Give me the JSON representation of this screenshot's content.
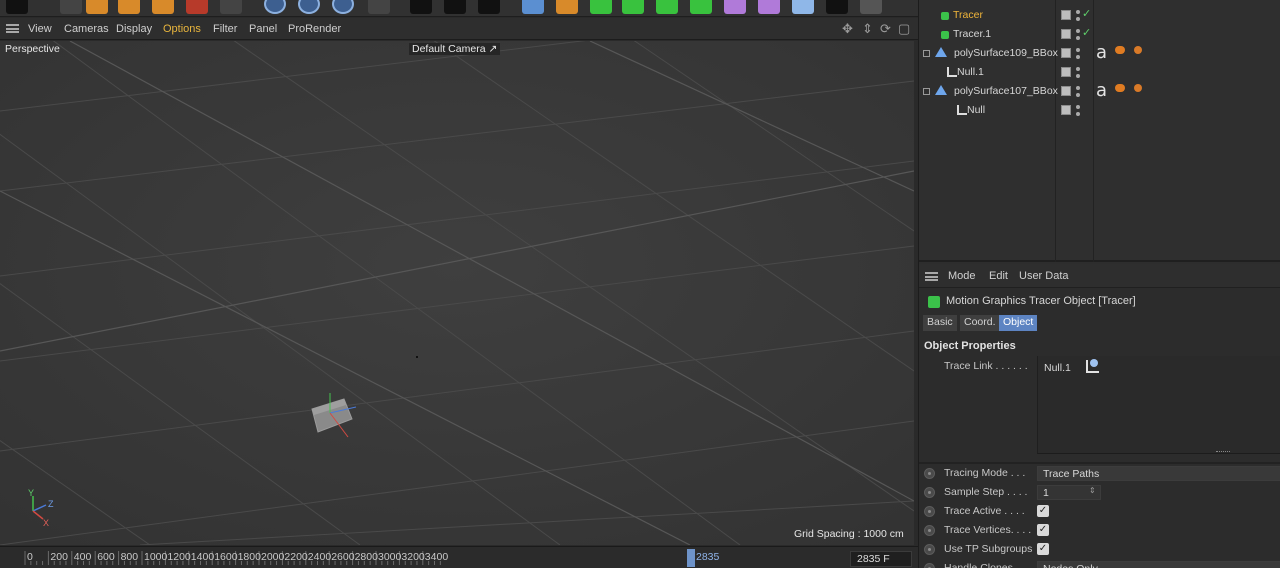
{
  "viewport": {
    "menu": [
      "View",
      "Cameras",
      "Display",
      "Options",
      "Filter",
      "Panel",
      "ProRender"
    ],
    "active_menu": "Options",
    "view_name": "Perspective",
    "camera_name": "Default Camera",
    "camera_suffix": "↗",
    "grid_spacing": "Grid Spacing : 1000 cm",
    "axis_labels": {
      "y": "Y",
      "z": "Z",
      "x": "X"
    }
  },
  "timeline": {
    "ticks": [
      "0",
      "200",
      "400",
      "600",
      "800",
      "1000",
      "1200",
      "1400",
      "1600",
      "1800",
      "2000",
      "2200",
      "2400",
      "2600",
      "2800",
      "3000",
      "3200",
      "3400"
    ],
    "current_frame": "2835",
    "frame_field": "2835 F"
  },
  "object_manager": {
    "rows": [
      {
        "name": "Tracer",
        "selected": true,
        "icon": "tracer-icon",
        "check": true
      },
      {
        "name": "Tracer.1",
        "selected": false,
        "icon": "tracer-icon",
        "check": true
      },
      {
        "name": "polySurface109_BBox",
        "selected": false,
        "icon": "polygon-object-icon",
        "tags": true
      },
      {
        "name": "Null.1",
        "selected": false,
        "icon": "null-icon"
      },
      {
        "name": "polySurface107_BBox",
        "selected": false,
        "icon": "polygon-object-icon",
        "tags": true
      },
      {
        "name": "Null",
        "selected": false,
        "icon": "null-icon"
      }
    ]
  },
  "attributes": {
    "menu": [
      "Mode",
      "Edit",
      "User Data"
    ],
    "title": "Motion Graphics Tracer Object [Tracer]",
    "tabs": [
      "Basic",
      "Coord.",
      "Object"
    ],
    "active_tab": "Object",
    "section": "Object Properties",
    "trace_link_label": "Trace Link . . . . . .",
    "trace_link_value": "Null.1",
    "props": [
      {
        "label": "Tracing Mode . . .",
        "value": "Trace Paths",
        "type": "dropdown"
      },
      {
        "label": "Sample Step . . . .",
        "value": "1",
        "type": "number"
      },
      {
        "label": "Trace Active . . . .",
        "value": "✓",
        "type": "checkbox"
      },
      {
        "label": "Trace Vertices. . . .",
        "value": "✓",
        "type": "checkbox"
      },
      {
        "label": "Use TP Subgroups",
        "value": "✓",
        "type": "checkbox"
      },
      {
        "label": "Handle Clones",
        "value": "Nodes Only",
        "type": "dropdown"
      }
    ]
  },
  "colors": {
    "accent": "#e8b53d",
    "selected_tab": "#5d84c2",
    "viewport_bg": "#3a3a3a",
    "panel_bg": "#2d2d2d"
  }
}
